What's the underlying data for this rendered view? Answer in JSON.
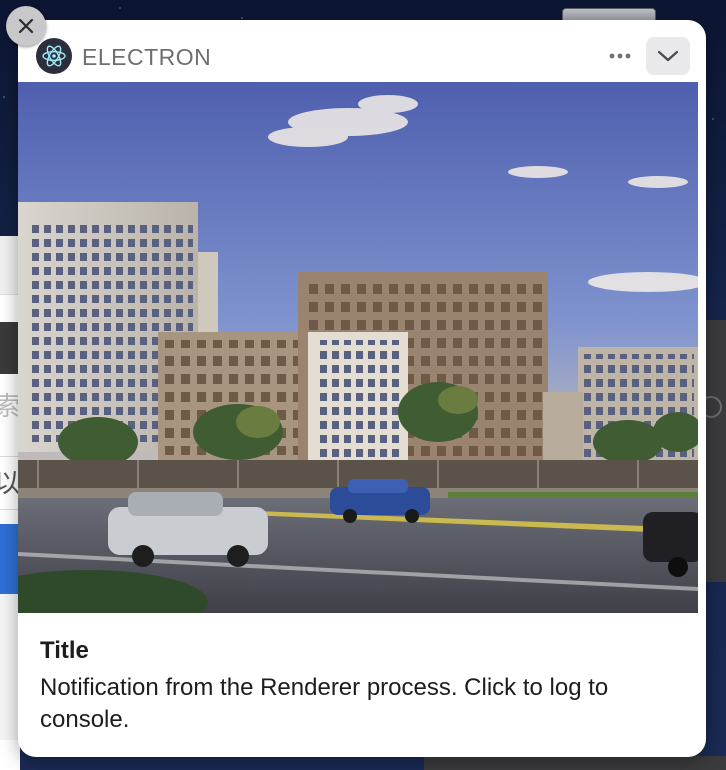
{
  "notification": {
    "app_name": "ELECTRON",
    "title": "Title",
    "body": "Notification from the Renderer process. Click to log to console.",
    "icons": {
      "app": "electron-atom-icon",
      "close": "close-icon",
      "more": "more-dots-icon",
      "collapse": "chevron-down-icon"
    },
    "image_description_alt": "Residential apartment buildings with cars on street"
  },
  "background": {
    "left_field_1_text": "索",
    "left_field_2_text": "以"
  },
  "colors": {
    "card_bg": "#ffffff",
    "title_text": "#1d1d1f",
    "app_name_text": "#6f6f6f",
    "collapse_button_bg": "#e9e9eb",
    "close_button_bg": "#c8c8ca"
  }
}
